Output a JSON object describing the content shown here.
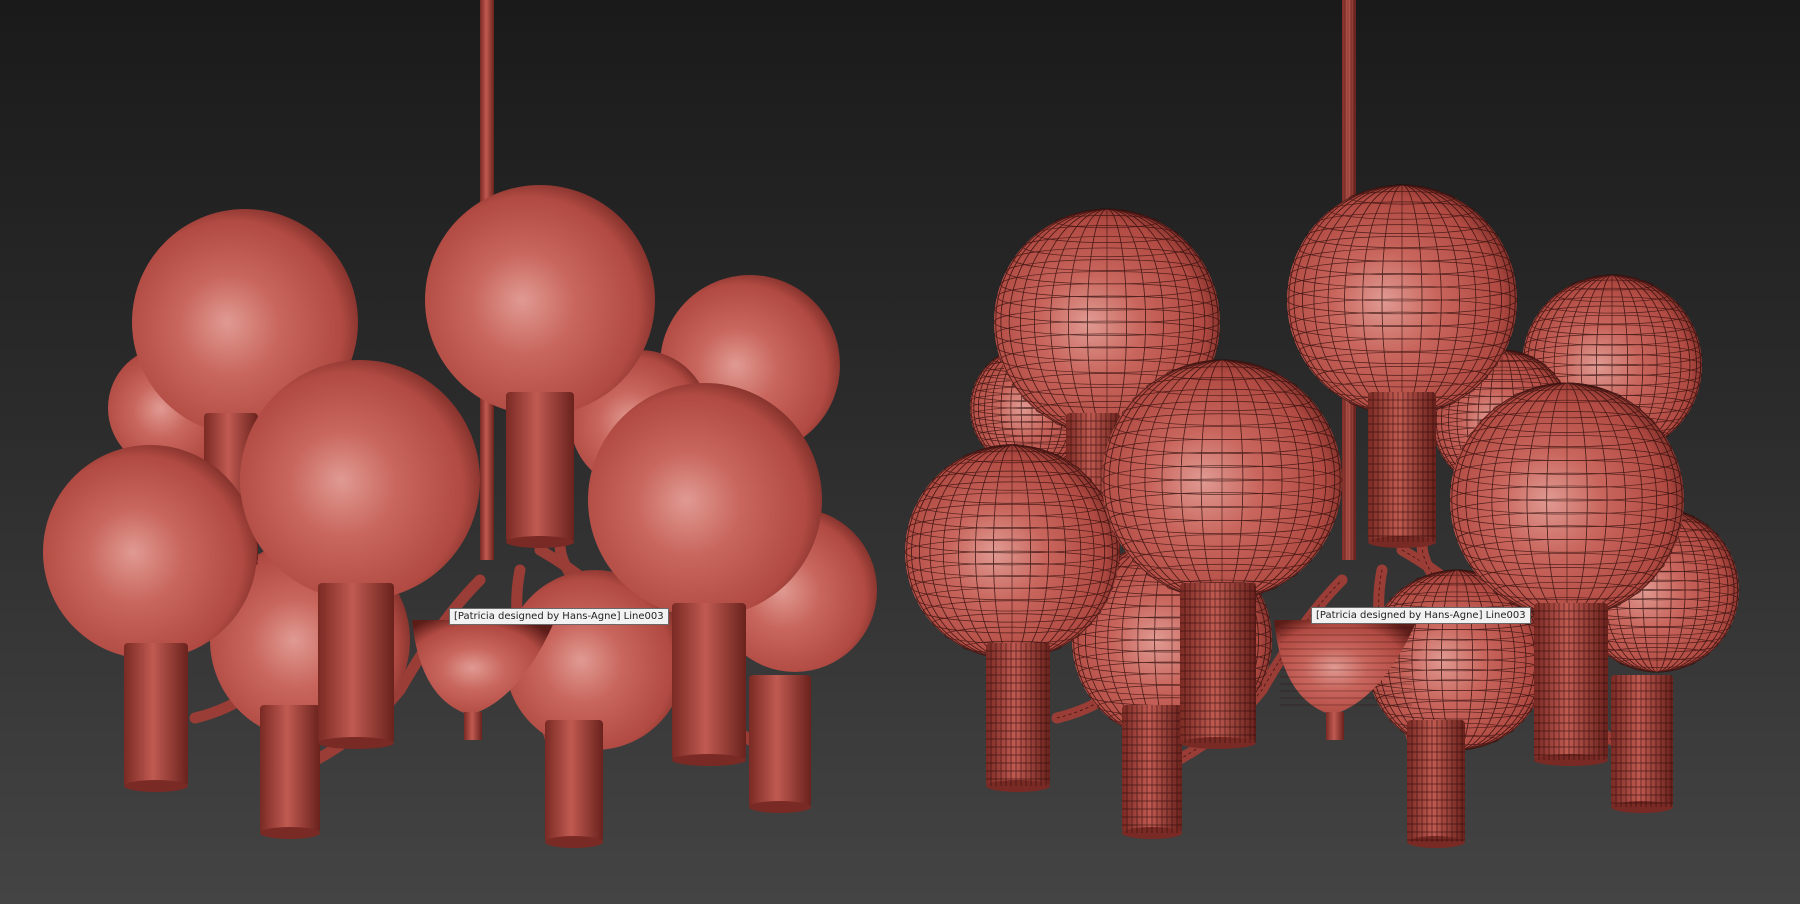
{
  "viewports": [
    {
      "id": "shaded",
      "display_mode": "shaded",
      "tooltip": "[Patricia designed by Hans-Agne] Line003"
    },
    {
      "id": "wireframe",
      "display_mode": "shaded-wireframe",
      "tooltip": "[Patricia designed by Hans-Agne] Line003"
    }
  ],
  "colors": {
    "background_top": "#1a1a1a",
    "background_bottom": "#444444",
    "model": "#b04a42",
    "model_highlight": "#e09a92",
    "model_shadow": "#5c1c18",
    "wire": "#2a0a08"
  },
  "icons": {
    "model": "chandelier-model"
  }
}
